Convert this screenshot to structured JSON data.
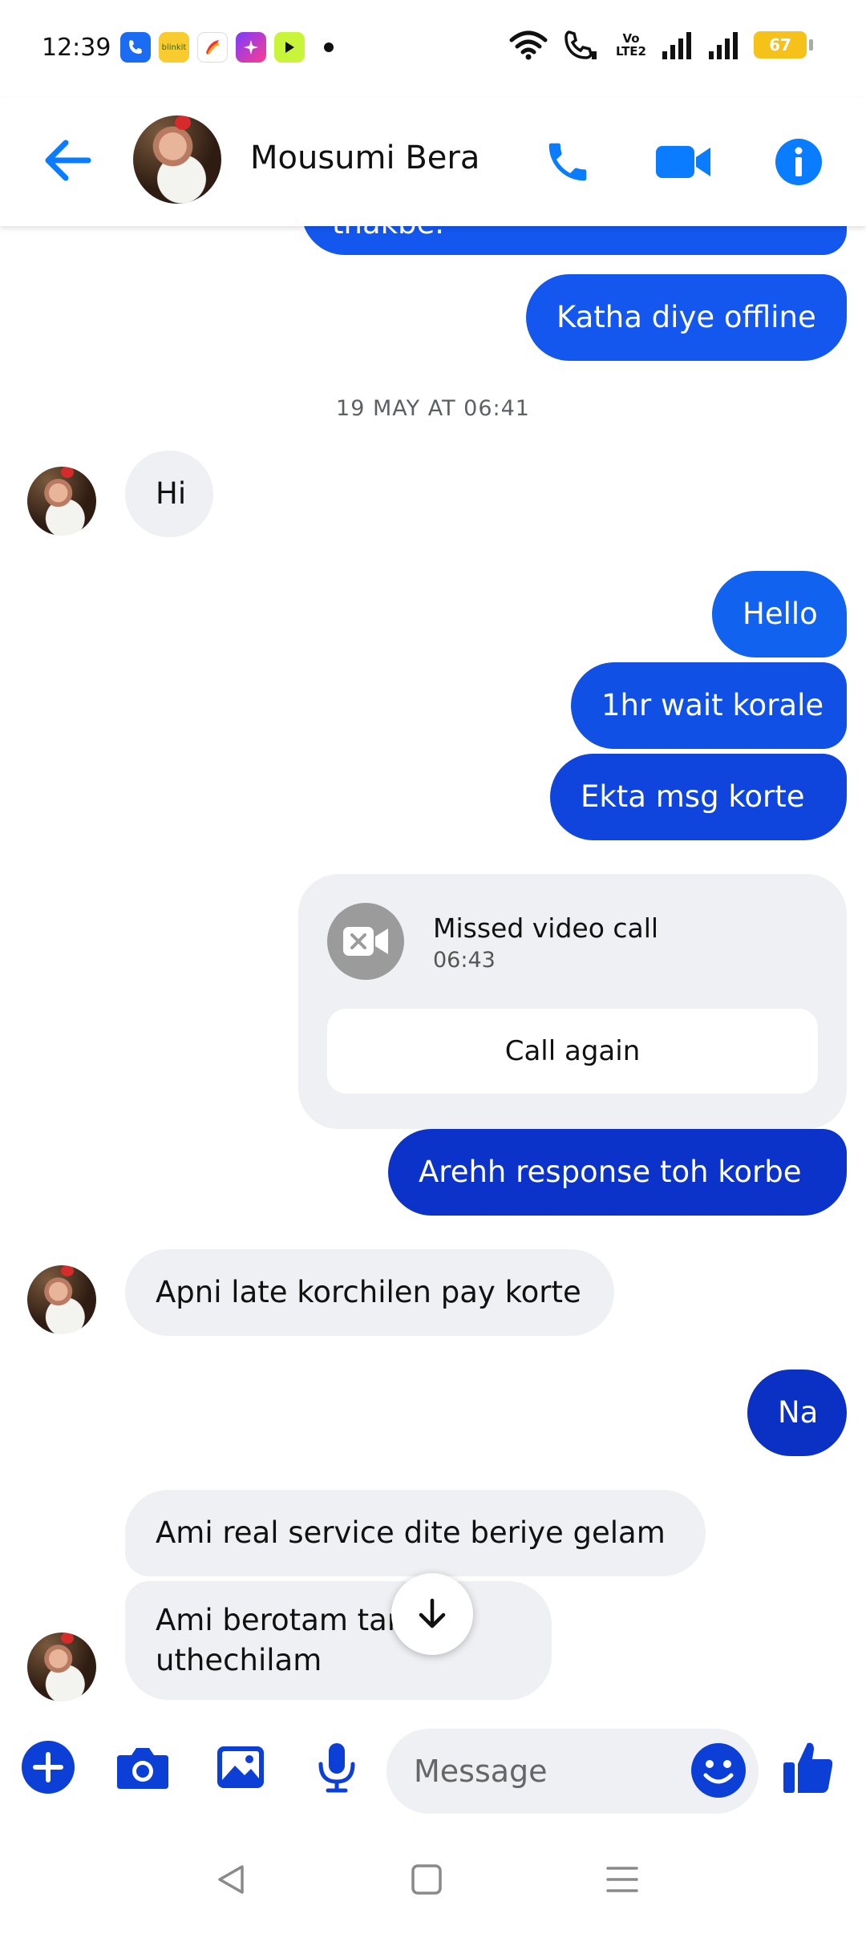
{
  "status_bar": {
    "time": "12:39",
    "volte_top": "Vo",
    "volte_bottom": "LTE2",
    "battery": "67",
    "app_icons": [
      "phone-app-icon",
      "blinkit-app-icon",
      "app-icon",
      "gallery-app-icon",
      "app-icon"
    ],
    "blinkit_label": "blinkit"
  },
  "header": {
    "contact_name": "Mousumi Bera"
  },
  "messages": {
    "m0": "thakbe.",
    "m1": "Katha diye offline",
    "timestamp": "19 MAY AT 06:41",
    "m2": "Hi",
    "m3": "Hello",
    "m4": "1hr wait korale",
    "m5": "Ekta msg korte",
    "missed_call_title": "Missed video call",
    "missed_call_time": "06:43",
    "call_again_label": "Call again",
    "m6": "Arehh response toh korbe",
    "m7": "Apni late korchilen pay korte",
    "m8": "Na",
    "m9": "Ami real service dite beriye gelam",
    "m10_line1": "Ami berotam tar age",
    "m10_line2": "uthechilam"
  },
  "composer": {
    "placeholder": "Message"
  },
  "colors": {
    "accent": "#0a7cff",
    "bubble_out_top": "#1262f0",
    "bubble_out_bottom": "#0c32c8",
    "bubble_in": "#eff0f4"
  }
}
